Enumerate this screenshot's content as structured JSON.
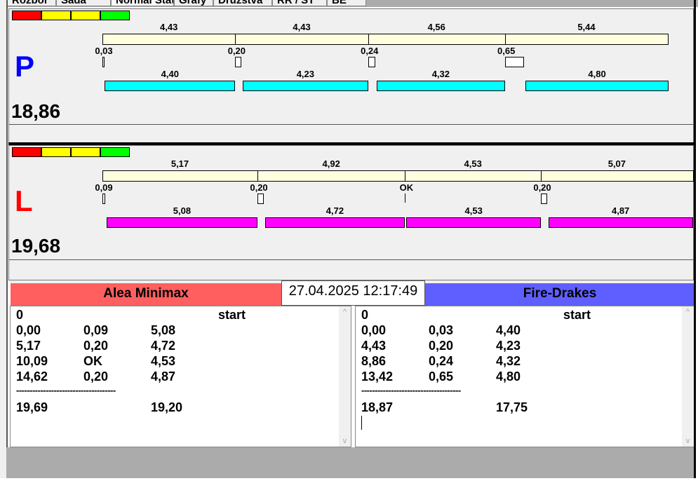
{
  "tabs": [
    "Rozbor",
    "Sada",
    "Normal Stat",
    "Grafy",
    "Družstva",
    "RR / ST",
    "BE"
  ],
  "colors": {
    "signal": [
      "#ff0000",
      "#ffff00",
      "#ffff00",
      "#00ff00"
    ],
    "p_actual": "#00ffff",
    "l_actual": "#ff00ff",
    "time_bar": "#ffffe0",
    "team_left": "#ff5f5f",
    "team_right": "#5f5fff"
  },
  "panels": [
    {
      "letter": "P",
      "letter_color": "#0000ff",
      "total": "18,86",
      "bar_color": "#00ffff",
      "segments": [
        {
          "time": 4.43,
          "time_label": "4,43",
          "gap": 0.03,
          "gap_label": "0,03",
          "actual": 4.4,
          "actual_label": "4,40"
        },
        {
          "time": 4.43,
          "time_label": "4,43",
          "gap": 0.2,
          "gap_label": "0,20",
          "actual": 4.23,
          "actual_label": "4,23"
        },
        {
          "time": 4.56,
          "time_label": "4,56",
          "gap": 0.24,
          "gap_label": "0,24",
          "actual": 4.32,
          "actual_label": "4,32"
        },
        {
          "time": 5.44,
          "time_label": "5,44",
          "gap": 0.65,
          "gap_label": "0,65",
          "actual": 4.8,
          "actual_label": "4,80"
        }
      ]
    },
    {
      "letter": "L",
      "letter_color": "#ff0000",
      "total": "19,68",
      "bar_color": "#ff00ff",
      "segments": [
        {
          "time": 5.17,
          "time_label": "5,17",
          "gap": 0.09,
          "gap_label": "0,09",
          "actual": 5.08,
          "actual_label": "5,08"
        },
        {
          "time": 4.92,
          "time_label": "4,92",
          "gap": 0.2,
          "gap_label": "0,20",
          "actual": 4.72,
          "actual_label": "4,72"
        },
        {
          "time": 4.53,
          "time_label": "4,53",
          "gap": 0,
          "gap_label": "OK",
          "actual": 4.53,
          "actual_label": "4,53"
        },
        {
          "time": 5.07,
          "time_label": "5,07",
          "gap": 0.2,
          "gap_label": "0,20",
          "actual": 4.87,
          "actual_label": "4,87"
        }
      ]
    }
  ],
  "datetime": "27.04.2025 12:17:49",
  "teams": [
    {
      "name": "Alea Minimax",
      "rows": [
        [
          "0",
          "",
          "",
          "start"
        ],
        [
          "0,00",
          "0,09",
          "5,08",
          ""
        ],
        [
          "5,17",
          "0,20",
          "4,72",
          ""
        ],
        [
          "10,09",
          "OK",
          "4,53",
          ""
        ],
        [
          "14,62",
          "0,20",
          "4,87",
          ""
        ]
      ],
      "divider": "-------------------------------------",
      "totals": [
        "19,69",
        "",
        "19,20"
      ]
    },
    {
      "name": "Fire-Drakes",
      "rows": [
        [
          "0",
          "",
          "",
          "start"
        ],
        [
          "0,00",
          "0,03",
          "4,40",
          ""
        ],
        [
          "4,43",
          "0,20",
          "4,23",
          ""
        ],
        [
          "8,86",
          "0,24",
          "4,32",
          ""
        ],
        [
          "13,42",
          "0,65",
          "4,80",
          ""
        ]
      ],
      "divider": "-------------------------------------",
      "totals": [
        "18,87",
        "",
        "17,75"
      ]
    }
  ]
}
